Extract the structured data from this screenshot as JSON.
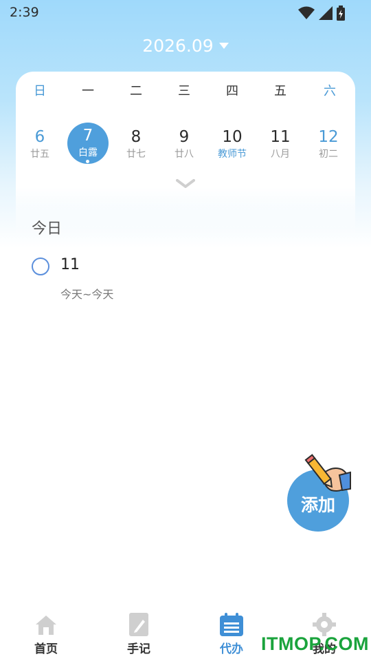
{
  "status": {
    "time": "2:39"
  },
  "header": {
    "month": "2026.09"
  },
  "weekdays": [
    "日",
    "一",
    "二",
    "三",
    "四",
    "五",
    "六"
  ],
  "dates": [
    {
      "day": "6",
      "sub": "廿五"
    },
    {
      "day": "7",
      "sub": "白露"
    },
    {
      "day": "8",
      "sub": "廿七"
    },
    {
      "day": "9",
      "sub": "廿八"
    },
    {
      "day": "10",
      "sub": "教师节"
    },
    {
      "day": "11",
      "sub": "八月"
    },
    {
      "day": "12",
      "sub": "初二"
    }
  ],
  "selected_date": "7",
  "section": {
    "title": "今日"
  },
  "todos": [
    {
      "title": "11",
      "range": "今天~今天"
    }
  ],
  "add_button": {
    "label": "添加"
  },
  "tabs": [
    {
      "label": "首页",
      "icon": "home-icon"
    },
    {
      "label": "手记",
      "icon": "notebook-icon"
    },
    {
      "label": "代办",
      "icon": "calendar-icon"
    },
    {
      "label": "我的",
      "icon": "gear-icon"
    }
  ],
  "active_tab": "代办",
  "watermark": "ITMOP.COM",
  "colors": {
    "accent": "#4f9fdc",
    "weekend": "#4a9ad6",
    "watermark": "#1aa33c"
  }
}
